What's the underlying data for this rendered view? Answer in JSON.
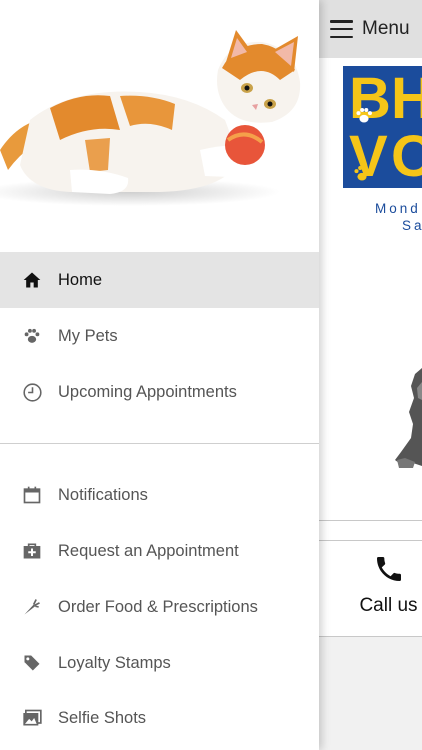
{
  "main": {
    "menu_label": "Menu",
    "logo_letters": [
      "B",
      "H",
      "V",
      "O"
    ],
    "hours_line1": "Mond",
    "hours_line2": "Sa",
    "call_label": "Call us"
  },
  "drawer": {
    "items": [
      {
        "label": "Home",
        "icon": "home-icon",
        "active": true
      },
      {
        "label": "My Pets",
        "icon": "paw-icon"
      },
      {
        "label": "Upcoming Appointments",
        "icon": "clock-icon"
      },
      {
        "label": "Notifications",
        "icon": "calendar-icon"
      },
      {
        "label": "Request an Appointment",
        "icon": "medical-bag-icon"
      },
      {
        "label": "Order Food & Prescriptions",
        "icon": "carrot-icon"
      },
      {
        "label": "Loyalty Stamps",
        "icon": "tag-icon"
      },
      {
        "label": "Selfie Shots",
        "icon": "photos-icon"
      }
    ]
  },
  "colors": {
    "brand_blue": "#1b4c9c",
    "brand_yellow": "#f5c518",
    "active_row": "#e4e4e4",
    "menu_button_bg": "#e0e0e0"
  }
}
